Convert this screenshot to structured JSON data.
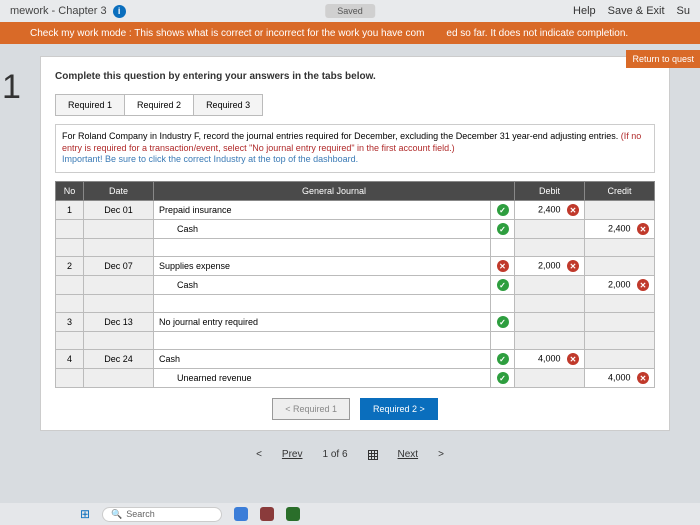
{
  "topbar": {
    "title": "mework - Chapter 3",
    "saved": "Saved",
    "help": "Help",
    "save_exit": "Save & Exit",
    "su": "Su"
  },
  "orange": {
    "text_left": "Check my work mode : This shows what is correct or incorrect for the work you have com",
    "text_right": "ed so far. It does not indicate completion."
  },
  "return_btn": "Return to quest",
  "question_num": "1",
  "card": {
    "instr1": "Complete this question by entering your answers in the tabs below.",
    "tabs": [
      "Required 1",
      "Required 2",
      "Required 3"
    ],
    "active_tab": 1,
    "instr_main": "For Roland Company in Industry F, record the journal entries required for December, excluding the December 31 year-end adjusting entries. ",
    "instr_red": "(If no entry is required for a transaction/event, select \"No journal entry required\" in the first account field.)",
    "instr_hint": "Important! Be sure to click the correct Industry at the top of the dashboard."
  },
  "table": {
    "headers": {
      "no": "No",
      "date": "Date",
      "gj": "General Journal",
      "debit": "Debit",
      "credit": "Credit"
    },
    "rows": [
      {
        "no": "1",
        "date": "Dec 01",
        "acct": "Prepaid insurance",
        "mark": "ok",
        "debit": "2,400",
        "debit_mark": "bad"
      },
      {
        "acct": "Cash",
        "indent": true,
        "mark": "ok",
        "credit": "2,400",
        "credit_mark": "bad"
      },
      {
        "spacer": true
      },
      {
        "no": "2",
        "date": "Dec 07",
        "acct": "Supplies expense",
        "mark": "bad",
        "debit": "2,000",
        "debit_mark": "bad"
      },
      {
        "acct": "Cash",
        "indent": true,
        "mark": "ok",
        "credit": "2,000",
        "credit_mark": "bad"
      },
      {
        "spacer": true
      },
      {
        "no": "3",
        "date": "Dec 13",
        "acct": "No journal entry required",
        "mark": "ok"
      },
      {
        "spacer": true
      },
      {
        "no": "4",
        "date": "Dec 24",
        "acct": "Cash",
        "mark": "ok",
        "debit": "4,000",
        "debit_mark": "bad"
      },
      {
        "acct": "Unearned revenue",
        "indent": true,
        "mark": "ok",
        "credit": "4,000",
        "credit_mark": "bad"
      }
    ]
  },
  "nav": {
    "prev_tab": "< Required 1",
    "next_tab": "Required 2  >"
  },
  "footer": {
    "prev": "Prev",
    "pos": "1 of 6",
    "next": "Next"
  },
  "taskbar": {
    "search": "Search"
  }
}
